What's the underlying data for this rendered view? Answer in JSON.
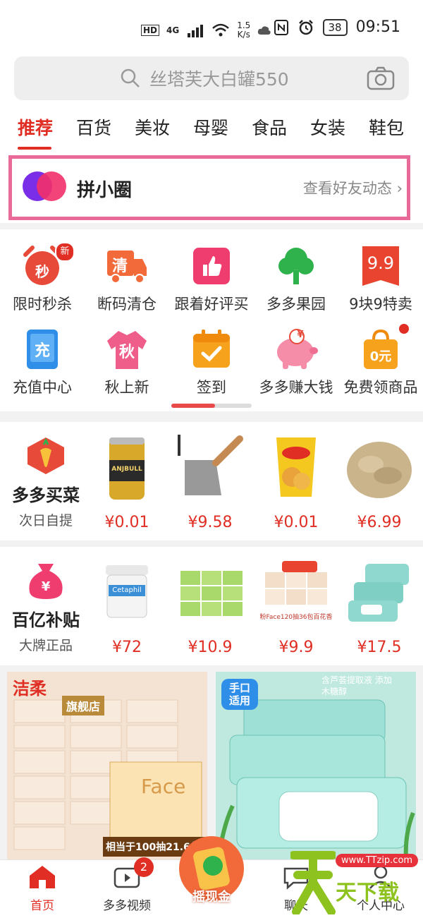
{
  "status_bar": {
    "hd": "HD",
    "network": "4G",
    "speed_value": "1.5",
    "speed_unit": "K/s",
    "battery": "38",
    "time": "09:51"
  },
  "search": {
    "placeholder": "丝塔芙大白罐550"
  },
  "tabs": [
    {
      "label": "推荐",
      "active": true
    },
    {
      "label": "百货"
    },
    {
      "label": "美妆"
    },
    {
      "label": "母婴"
    },
    {
      "label": "食品"
    },
    {
      "label": "女装"
    },
    {
      "label": "鞋包"
    }
  ],
  "friend_circle": {
    "title": "拼小圈",
    "link": "查看好友动态"
  },
  "shortcuts": [
    {
      "label": "限时秒杀",
      "icon": "alarm-clock-icon",
      "icon_text": "秒",
      "badge": "新",
      "color": "#e84a3a"
    },
    {
      "label": "断码清仓",
      "icon": "truck-icon",
      "icon_text": "清",
      "color": "#f26a3a"
    },
    {
      "label": "跟着好评买",
      "icon": "thumbs-up-icon",
      "color": "#ef3d6f"
    },
    {
      "label": "多多果园",
      "icon": "tree-icon",
      "color": "#2fb24c"
    },
    {
      "label": "9块9特卖",
      "icon": "price-tag-icon",
      "icon_text": "9.9",
      "color": "#e8442f"
    },
    {
      "label": "充值中心",
      "icon": "phone-icon",
      "icon_text": "充",
      "color": "#2f8fe8"
    },
    {
      "label": "秋上新",
      "icon": "sweater-icon",
      "icon_text": "秋",
      "color": "#ef5d8a"
    },
    {
      "label": "签到",
      "icon": "calendar-check-icon",
      "color": "#f6a21d"
    },
    {
      "label": "多多赚大钱",
      "icon": "piggy-bank-icon",
      "icon_text": "¥",
      "color": "#f58ca8"
    },
    {
      "label": "免费领商品",
      "icon": "shopping-bag-icon",
      "icon_text": "0元",
      "color": "#f6a21d"
    }
  ],
  "grocery": {
    "title": "多多买菜",
    "subtitle": "次日自提",
    "products": [
      {
        "price": "¥0.01",
        "label": "ANJBULL"
      },
      {
        "price": "¥9.58"
      },
      {
        "price": "¥0.01"
      },
      {
        "price": "¥6.99"
      }
    ]
  },
  "subsidy": {
    "title": "百亿补贴",
    "subtitle": "大牌正品",
    "products": [
      {
        "price": "¥72",
        "label": "Cetaphil"
      },
      {
        "price": "¥10.9"
      },
      {
        "price": "¥9.9",
        "caption": "粉Face120抽36包百花香"
      },
      {
        "price": "¥17.5"
      }
    ]
  },
  "banners": [
    {
      "brand": "洁柔",
      "tag": "旗舰店",
      "product": "Face",
      "caption": "相当于100抽21.6包"
    },
    {
      "tag": "手口适用",
      "text": "含芦荟提取液 添加木糖醇"
    }
  ],
  "bottom_nav": [
    {
      "label": "首页",
      "active": true
    },
    {
      "label": "多多视频",
      "badge": "2"
    },
    {
      "label": "摇现金"
    },
    {
      "label": "聊天"
    },
    {
      "label": "个人中心"
    }
  ],
  "watermark": {
    "url": "www.TTzip.com",
    "text": "天下载"
  },
  "colors": {
    "accent": "#e02e24",
    "highlight_box": "#e86a98"
  }
}
